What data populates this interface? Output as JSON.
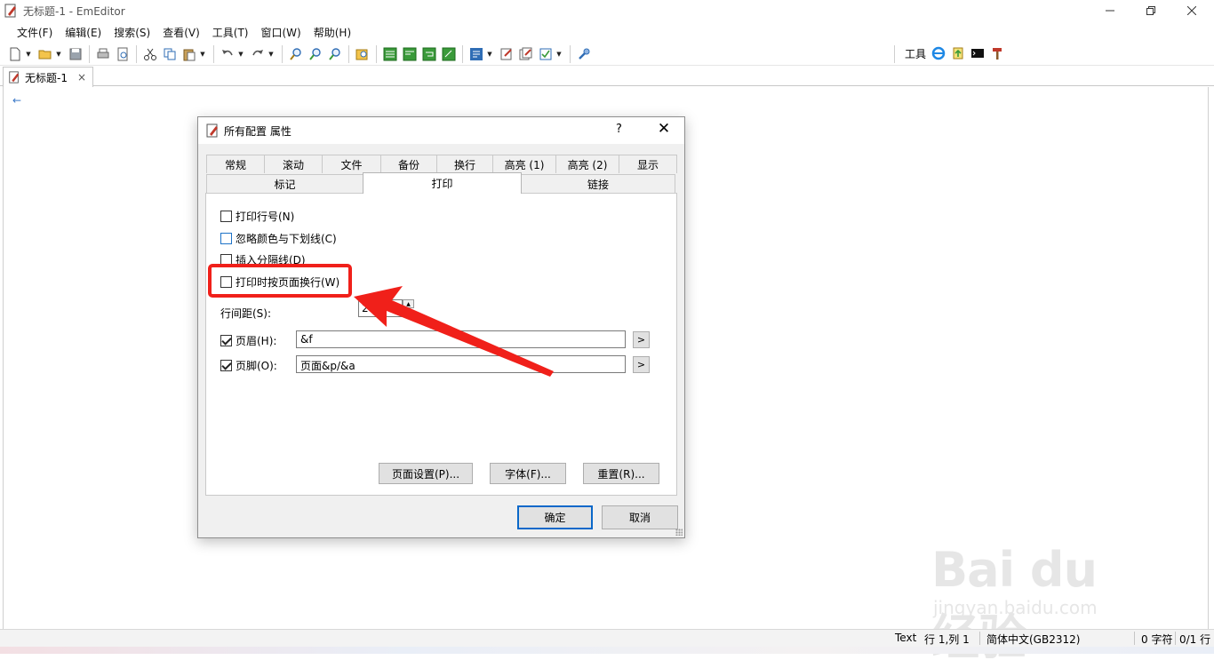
{
  "window": {
    "title": "无标题-1 - EmEditor"
  },
  "menu": [
    "文件(F)",
    "编辑(E)",
    "搜索(S)",
    "查看(V)",
    "工具(T)",
    "窗口(W)",
    "帮助(H)"
  ],
  "toolbar": {
    "tools_label": "工具"
  },
  "doc_tab": {
    "label": "无标题-1",
    "close": "×"
  },
  "editor": {
    "eol_mark": "←"
  },
  "dialog": {
    "title": "所有配置 属性",
    "help": "?",
    "close": "✕",
    "tabs_row1": [
      "常规",
      "滚动",
      "文件",
      "备份",
      "换行",
      "高亮 (1)",
      "高亮 (2)",
      "显示"
    ],
    "tabs_row2": [
      "标记",
      "打印",
      "链接"
    ],
    "active_tab": "打印",
    "options": {
      "print_line_numbers": {
        "label": "打印行号(N)",
        "checked": false
      },
      "ignore_colors": {
        "label": "忽略颜色与下划线(C)",
        "checked": false
      },
      "insert_separator": {
        "label": "插入分隔线(D)",
        "checked": false
      },
      "wrap_by_page": {
        "label": "打印时按页面换行(W)",
        "checked": false
      }
    },
    "line_spacing": {
      "label": "行间距(S):",
      "value": "2"
    },
    "header": {
      "label": "页眉(H):",
      "value": "&f",
      "checked": true,
      "arrow": ">"
    },
    "footer": {
      "label": "页脚(O):",
      "value": "页面&p/&a",
      "checked": true,
      "arrow": ">"
    },
    "buttons": {
      "page_setup": "页面设置(P)...",
      "font": "字体(F)...",
      "reset": "重置(R)...",
      "ok": "确定",
      "cancel": "取消"
    }
  },
  "status": {
    "mode": "Text",
    "position": "行 1,列 1",
    "encoding": "简体中文(GB2312)",
    "chars": "0 字符",
    "lines": "0/1 行"
  },
  "watermark": {
    "logo": "Bai du 经验",
    "url": "jingyan.baidu.com"
  },
  "colors": {
    "annotation_red": "#f0201a",
    "default_button_border": "#0a68c9"
  }
}
